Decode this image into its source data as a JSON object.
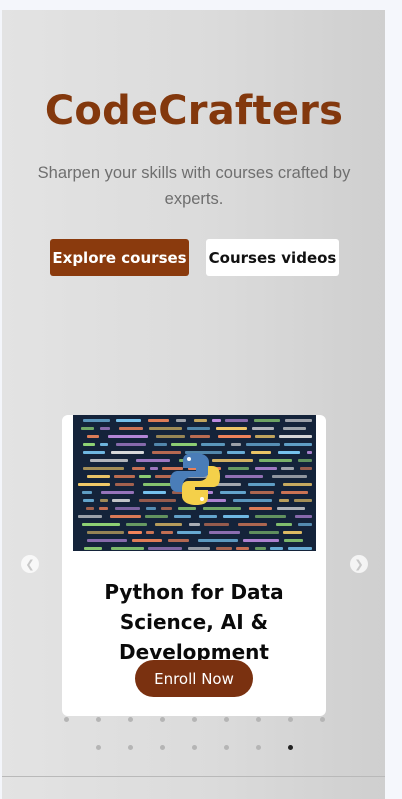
{
  "hero": {
    "title": "CodeCrafters",
    "tagline": "Sharpen your skills with courses crafted by experts.",
    "primary_button": "Explore courses",
    "secondary_button": "Courses videos",
    "title_color": "#83380d"
  },
  "carousel": {
    "card": {
      "image_icon": "python-logo-icon",
      "title": "Python for Data Science, AI & Development",
      "enroll_label": "Enroll Now"
    },
    "prev_icon": "chevron-left-icon",
    "next_icon": "chevron-right-icon",
    "top_dot_count": 9,
    "bottom_dot_count": 7,
    "active_bottom_dot": 6
  },
  "colors": {
    "accent": "#8a3a0d",
    "enroll": "#7a3110",
    "code_bg": "#14233a"
  }
}
